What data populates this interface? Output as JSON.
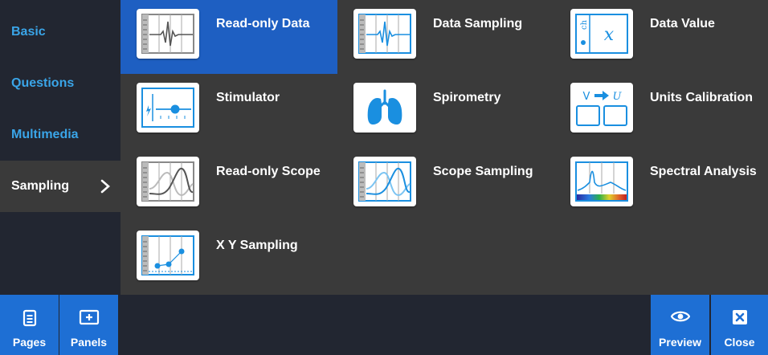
{
  "sidebar": {
    "items": [
      {
        "label": "Basic"
      },
      {
        "label": "Questions"
      },
      {
        "label": "Multimedia"
      },
      {
        "label": "Sampling",
        "active": true
      }
    ]
  },
  "tiles": [
    {
      "label": "Read-only Data",
      "icon": "read-only-data-icon",
      "selected": true
    },
    {
      "label": "Data Sampling",
      "icon": "data-sampling-icon"
    },
    {
      "label": "Data Value",
      "icon": "data-value-icon"
    },
    {
      "label": "Stimulator",
      "icon": "stimulator-icon"
    },
    {
      "label": "Spirometry",
      "icon": "lungs-icon"
    },
    {
      "label": "Units Calibration",
      "icon": "units-calibration-icon"
    },
    {
      "label": "Read-only Scope",
      "icon": "read-only-scope-icon"
    },
    {
      "label": "Scope Sampling",
      "icon": "scope-sampling-icon"
    },
    {
      "label": "Spectral Analysis",
      "icon": "spectral-analysis-icon"
    },
    {
      "label": "X Y Sampling",
      "icon": "xy-sampling-icon"
    }
  ],
  "units_calibration_icon": {
    "from": "V",
    "to": "U"
  },
  "data_value_icon": {
    "variable": "x",
    "channel": "ch"
  },
  "bottombar": {
    "pages_label": "Pages",
    "panels_label": "Panels",
    "preview_label": "Preview",
    "close_label": "Close"
  },
  "colors": {
    "accent": "#1e6fd4",
    "selected_tile": "#1e5fc2",
    "sidebar_link": "#3aa5e8",
    "icon_blue": "#1a8fe0"
  }
}
